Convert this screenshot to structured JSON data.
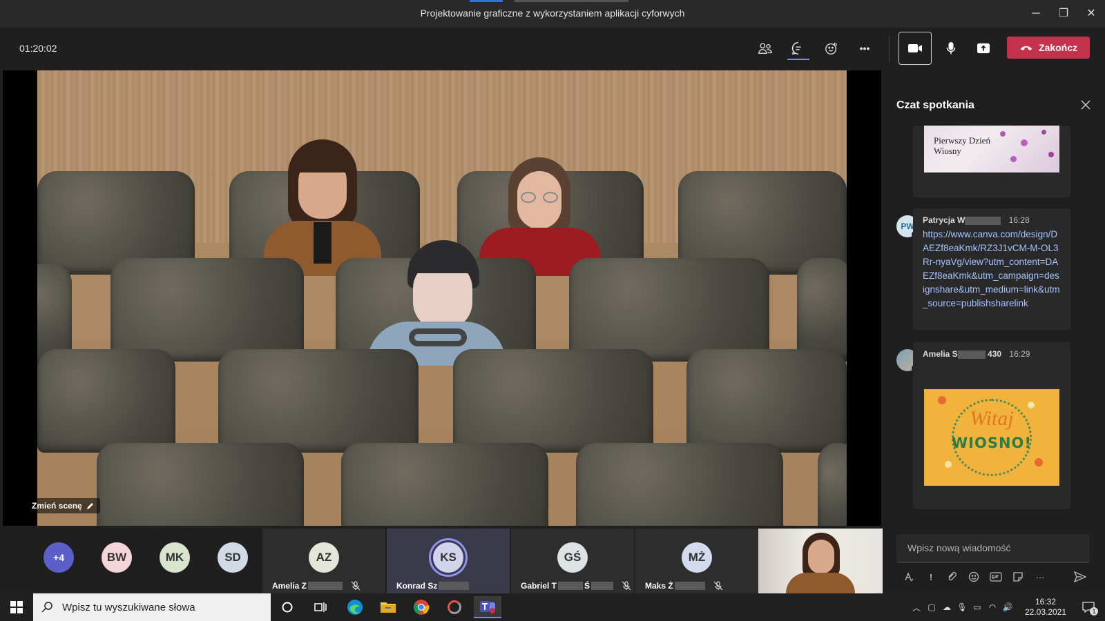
{
  "window": {
    "title": "Projektowanie graficzne z wykorzystaniem aplikacji cyforwych",
    "minimize": "─",
    "restore": "❐",
    "close": "✕"
  },
  "toolbar": {
    "timer": "01:20:02",
    "end_label": "Zakończ",
    "more": "•••"
  },
  "stage": {
    "change_scene_label": "Zmień scenę"
  },
  "chat": {
    "title": "Czat spotkania",
    "image_text": "Pierwszy Dzień Wiosny",
    "messages": [
      {
        "initials": "PW",
        "sender": "Patrycja W",
        "time": "16:28",
        "text": "https://www.canva.com/design/DAEZf8eaKmk/RZ3J1vCM-M-OL3Rr-nyaVg/view?utm_content=DAEZf8eaKmk&utm_campaign=designshare&utm_medium=link&utm_source=publishsharelink"
      },
      {
        "initials": "",
        "sender": "Amelia S",
        "sender_suffix": "430",
        "time": "16:29",
        "card_line1": "Witaj",
        "card_line2": "WIOSNO!"
      }
    ],
    "compose_placeholder": "Wpisz nową wiadomość"
  },
  "participants": {
    "overflow": "+4",
    "avatars": [
      "BW",
      "MK",
      "SD"
    ],
    "tiles": [
      {
        "initials": "AZ",
        "name": "Amelia Z"
      },
      {
        "initials": "KS",
        "name": "Konrad Sz"
      },
      {
        "initials": "GŚ",
        "name": "Gabriel T",
        "name_suffix": "Ś"
      },
      {
        "initials": "MŻ",
        "name": "Maks Ż"
      }
    ]
  },
  "taskbar": {
    "search_placeholder": "Wpisz tu wyszukiwane słowa",
    "time": "16:32",
    "date": "22.03.2021",
    "notifications": "1"
  }
}
